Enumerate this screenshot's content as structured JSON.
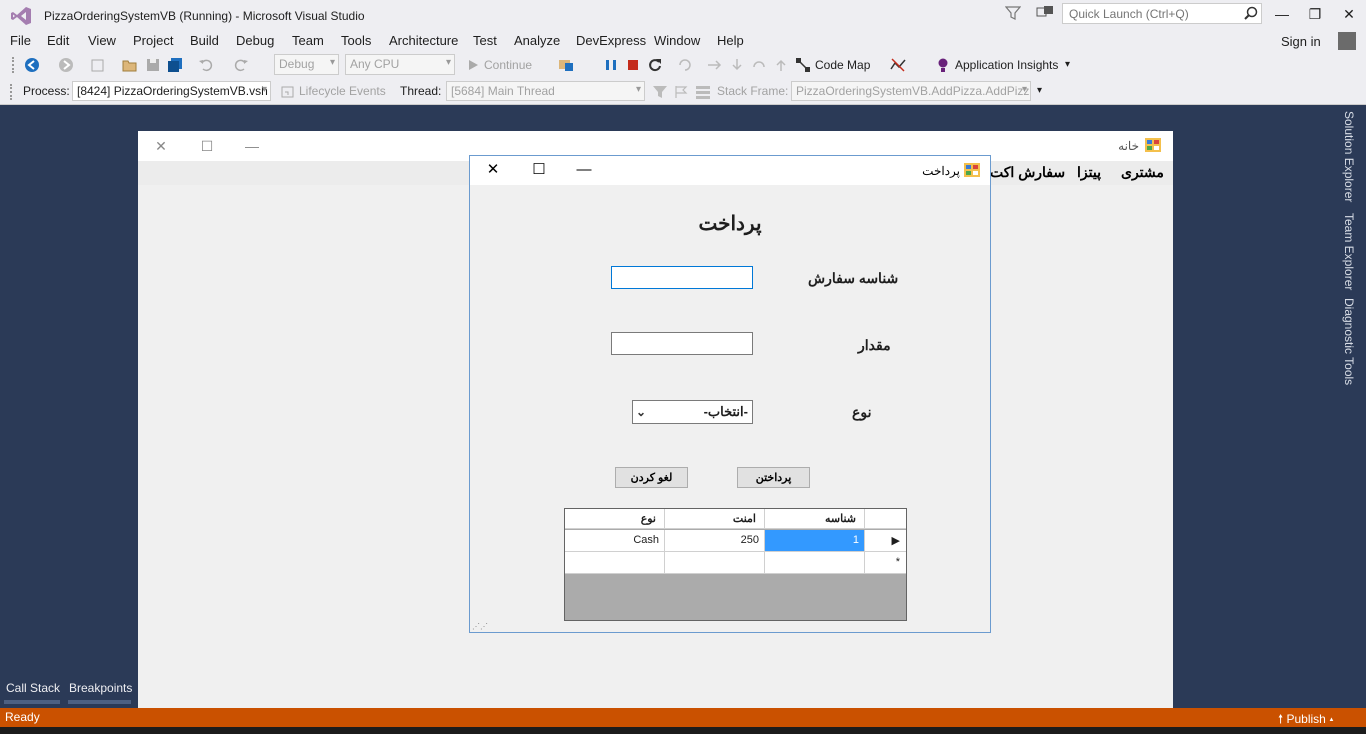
{
  "vs": {
    "title": "PizzaOrderingSystemVB (Running) - Microsoft Visual Studio",
    "quick_launch_placeholder": "Quick Launch (Ctrl+Q)",
    "sign_in": "Sign in",
    "menu": [
      "File",
      "Edit",
      "View",
      "Project",
      "Build",
      "Debug",
      "Team",
      "Tools",
      "Architecture",
      "Test",
      "Analyze",
      "DevExpress",
      "Window",
      "Help"
    ],
    "toolbar": {
      "config": "Debug",
      "platform": "Any CPU",
      "continue": "Continue",
      "code_map": "Code Map",
      "app_insights": "Application Insights"
    },
    "debugbar": {
      "process_label": "Process:",
      "process_value": "[8424] PizzaOrderingSystemVB.vsh",
      "lifecycle": "Lifecycle Events",
      "thread_label": "Thread:",
      "thread_value": "[5684] Main Thread",
      "stack_label": "Stack Frame:",
      "stack_value": "PizzaOrderingSystemVB.AddPizza.AddPizz"
    },
    "right_tabs": [
      "Solution Explorer",
      "Team Explorer",
      "Diagnostic Tools"
    ],
    "bottom_tabs": [
      "Call Stack",
      "Breakpoints"
    ],
    "status": "Ready",
    "publish": "Publish",
    "colors": {
      "status_bar": "#ca5100",
      "background": "#2b3a57",
      "chrome": "#eeeef2"
    }
  },
  "app": {
    "main_title": "خانه",
    "menu": [
      "مشتری",
      "پیتزا",
      "سفارش اکت"
    ]
  },
  "payment": {
    "title": "پرداخت",
    "heading": "پرداخت",
    "order_id_label": "شناسه سفارش",
    "order_id_value": "",
    "amount_label": "مقدار",
    "amount_value": "",
    "type_label": "نوع",
    "type_selected": "-انتخاب-",
    "pay_button": "پرداختن",
    "cancel_button": "لغو کردن",
    "grid": {
      "columns": [
        "شناسه",
        "امنت",
        "نوع"
      ],
      "rows": [
        {
          "id": "1",
          "amount": "250",
          "type": "Cash"
        }
      ],
      "new_row_marker": "*",
      "current_row_marker": "▶"
    }
  }
}
